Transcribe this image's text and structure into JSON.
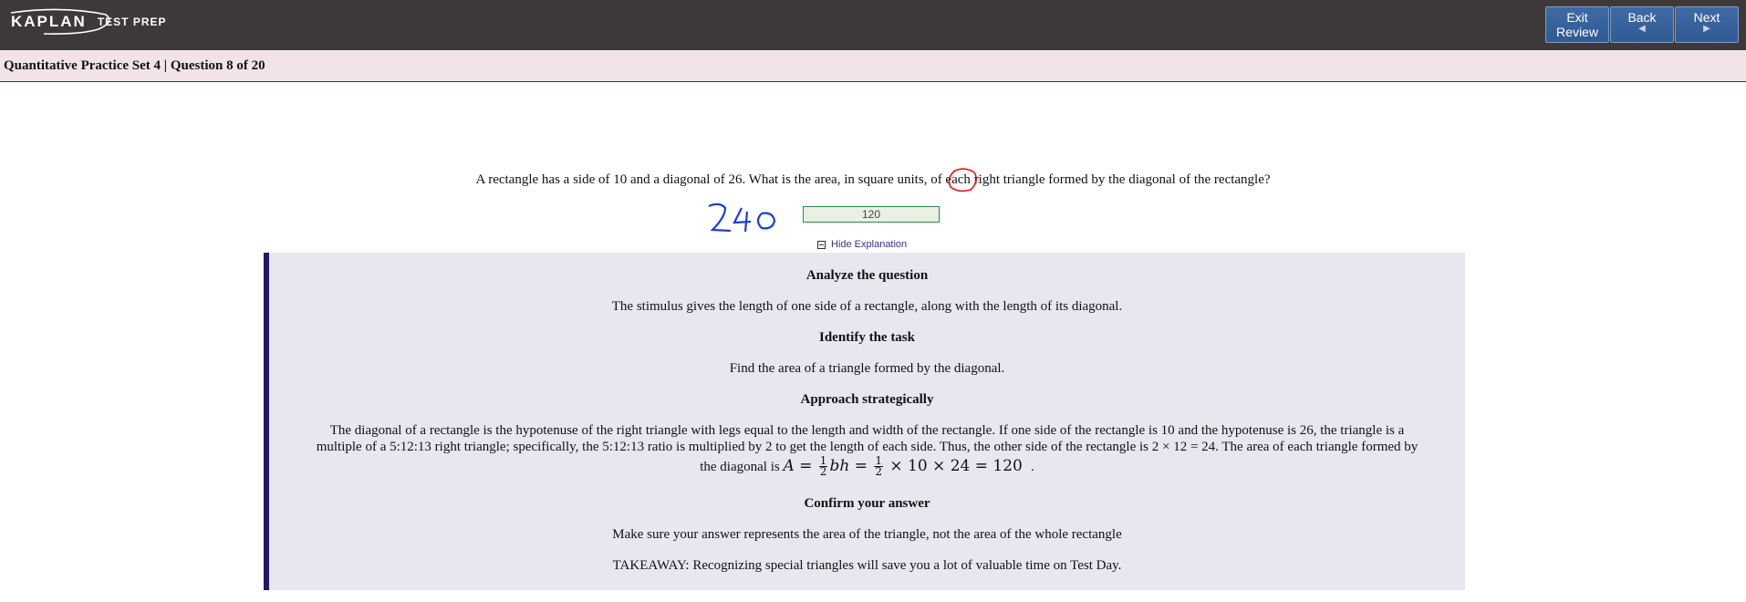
{
  "topbar": {
    "logo_word": "KAPLAN",
    "logo_sub": "TEST PREP",
    "buttons": {
      "exit_line1": "Exit",
      "exit_line2": "Review",
      "back_label": "Back",
      "back_arrow": "◀",
      "next_label": "Next",
      "next_arrow": "▶"
    },
    "colors": {
      "bar": "#3d3939",
      "button": "#2f5a94"
    }
  },
  "header": {
    "title": "Quantitative Practice Set 4 | Question 8 of 20"
  },
  "question": {
    "text": "A rectangle has a side of 10 and a diagonal of 26. What is the area, in square units, of each right triangle formed by the diagonal of the rectangle?",
    "handwritten_note": "240",
    "answer": "120",
    "toggle_label": "Hide Explanation"
  },
  "explanation": {
    "sections": [
      {
        "heading": "Analyze the question",
        "body": "The stimulus gives the length of one side of a rectangle, along with the length of its diagonal."
      },
      {
        "heading": "Identify the task",
        "body": "Find the area of a triangle formed by the diagonal."
      },
      {
        "heading": "Approach strategically",
        "body_line1": "The diagonal of a rectangle is the hypotenuse of the right triangle with legs equal to the length and width of the rectangle. If one side of the rectangle is 10 and the hypotenuse is 26, the triangle is a",
        "body_line2": "multiple of a 5:12:13 right triangle; specifically, the 5:12:13 ratio is multiplied by 2 to get the length of each side. Thus, the other side of the rectangle is 2 × 12 = 24. The area of each triangle formed by",
        "body_line3_prefix": "the diagonal is",
        "formula": {
          "var_a": "A",
          "eq": "=",
          "frac_num": "1",
          "frac_den": "2",
          "bh": "bh",
          "rest": "× 10 × 24 = 120",
          "period": "."
        }
      },
      {
        "heading": "Confirm your answer",
        "body": "Make sure your answer represents the area of the triangle, not the area of the whole rectangle"
      },
      {
        "takeaway": "TAKEAWAY: Recognizing special triangles will save you a lot of valuable time on Test Day."
      }
    ],
    "colors": {
      "panel": "#e8e7f0",
      "border": "#1f1a66"
    }
  }
}
